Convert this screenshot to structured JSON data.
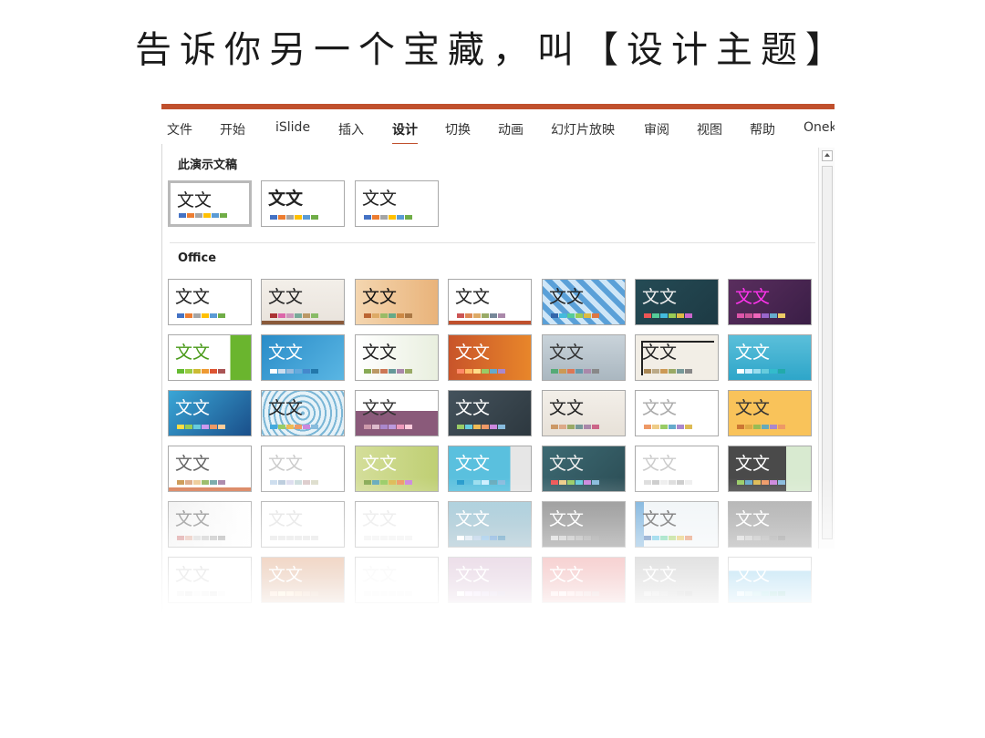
{
  "slide": {
    "title": "告诉你另一个宝藏，叫【设计主题】"
  },
  "ribbon": {
    "tabs": [
      "文件",
      "开始",
      "iSlide",
      "插入",
      "设计",
      "切换",
      "动画",
      "幻灯片放映",
      "审阅",
      "视图",
      "帮助",
      "Onek"
    ],
    "active_tab": "设计"
  },
  "sections": {
    "this_presentation": "此演示文稿",
    "office": "Office"
  },
  "theme_sample_text": "文文",
  "colors": {
    "accent": "#c0502d"
  },
  "this_presentation_themes": [
    {
      "name": "current-theme-1",
      "style": "plain",
      "selected": true
    },
    {
      "name": "current-theme-2",
      "style": "bold"
    },
    {
      "name": "current-theme-3",
      "style": "plain"
    }
  ],
  "office_themes_rows": 6,
  "office_themes_cols": 7,
  "scrollbar": {
    "icon": "chevron-up-icon"
  }
}
